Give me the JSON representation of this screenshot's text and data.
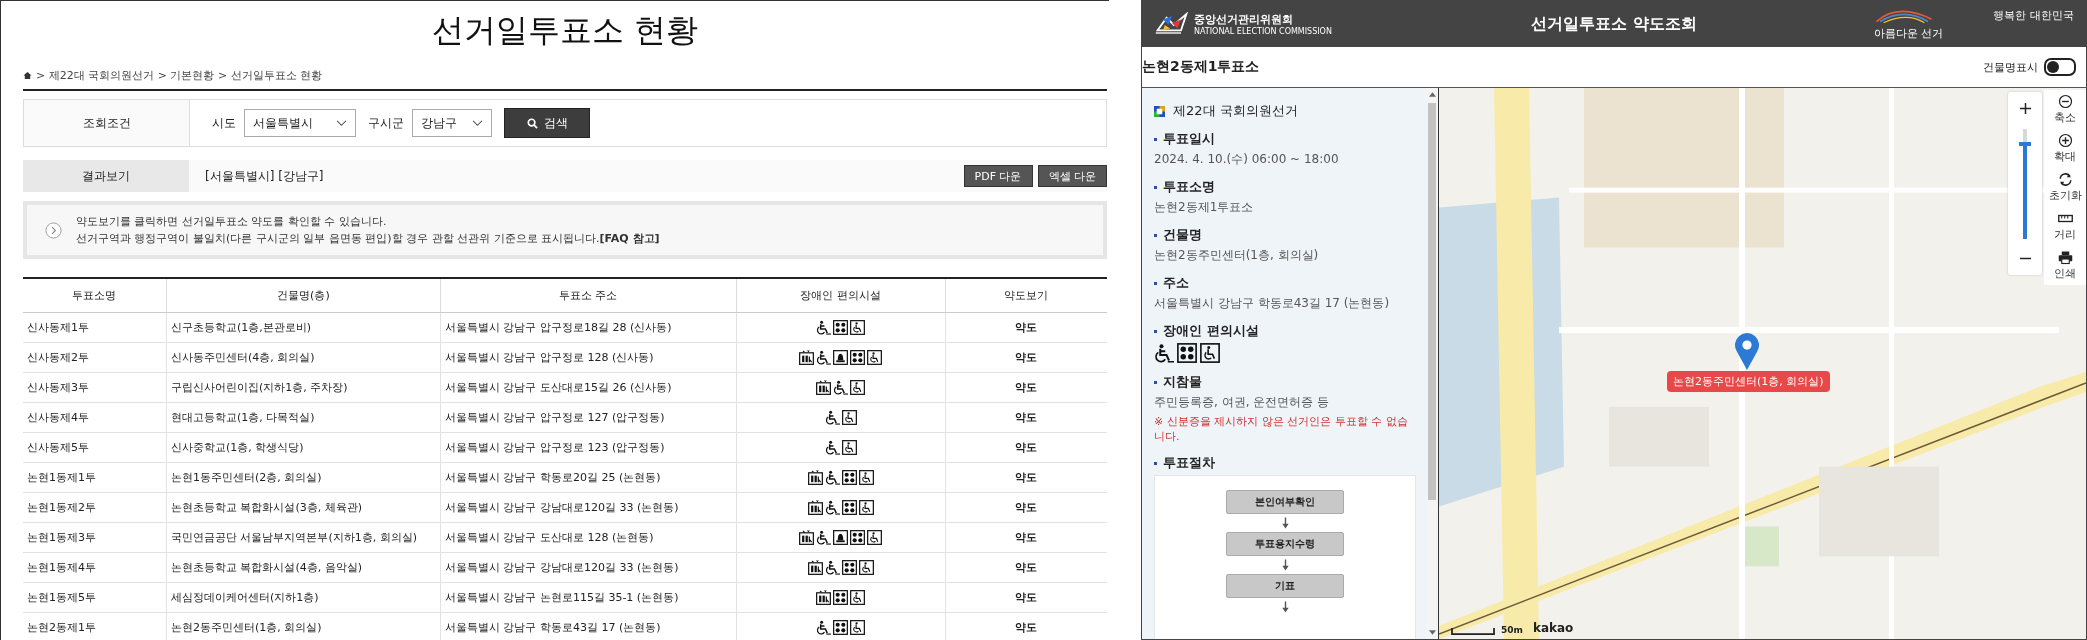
{
  "left": {
    "title": "선거일투표소 현황",
    "breadcrumb": "> 제22대 국회의원선거 > 기본현황 > 선거일투표소 현황",
    "filter": {
      "label": "조회조건",
      "fields": [
        {
          "label": "시도",
          "value": "서울특별시"
        },
        {
          "label": "구시군",
          "value": "강남구"
        }
      ],
      "search_button": "검색"
    },
    "results": {
      "label": "결과보기",
      "summary": "[서울특별시] [강남구]",
      "buttons": [
        "PDF 다운",
        "엑셀 다운"
      ]
    },
    "notice": [
      "약도보기를 클릭하면 선거일투표소 약도를 확인할 수 있습니다.",
      "선거구역과 행정구역이 불일치(다른 구시군의 일부 읍면동 편입)할 경우 관할 선관위 기준으로 표시됩니다.**[FAQ 참고]**"
    ],
    "table": {
      "columns": [
        "투표소명",
        "건물명(층)",
        "투표소 주소",
        "장애인 편의시설",
        "약도보기"
      ],
      "rows": [
        {
          "name": "신사동제1투",
          "building": "신구초등학교(1층,본관로비)",
          "address": "서울특별시 강남구 압구정로18길 28 (신사동)",
          "facilities": [
            {
              "kind": "ramp"
            },
            {
              "kind": "braille"
            },
            {
              "kind": "toilet"
            }
          ],
          "map_link": "약도"
        },
        {
          "name": "신사동제2투",
          "building": "신사동주민센터(4층, 회의실)",
          "address": "서울특별시 강남구 압구정로 128 (신사동)",
          "facilities": [
            {
              "kind": "lift"
            },
            {
              "kind": "ramp"
            },
            {
              "kind": "bell"
            },
            {
              "kind": "braille"
            },
            {
              "kind": "toilet"
            }
          ],
          "map_link": "약도"
        },
        {
          "name": "신사동제3투",
          "building": "구립신사어린이집(지하1층, 주차장)",
          "address": "서울특별시 강남구 도산대로15길 26 (신사동)",
          "facilities": [
            {
              "kind": "lift"
            },
            {
              "kind": "ramp"
            },
            {
              "kind": "toilet"
            }
          ],
          "map_link": "약도"
        },
        {
          "name": "신사동제4투",
          "building": "현대고등학교(1층, 다목적실)",
          "address": "서울특별시 강남구 압구정로 127 (압구정동)",
          "facilities": [
            {
              "kind": "ramp"
            },
            {
              "kind": "toilet"
            }
          ],
          "map_link": "약도"
        },
        {
          "name": "신사동제5투",
          "building": "신사중학교(1층, 학생식당)",
          "address": "서울특별시 강남구 압구정로 123 (압구정동)",
          "facilities": [
            {
              "kind": "ramp"
            },
            {
              "kind": "toilet"
            }
          ],
          "map_link": "약도"
        },
        {
          "name": "논현1동제1투",
          "building": "논현1동주민센터(2층, 회의실)",
          "address": "서울특별시 강남구 학동로20길 25 (논현동)",
          "facilities": [
            {
              "kind": "lift"
            },
            {
              "kind": "ramp"
            },
            {
              "kind": "braille"
            },
            {
              "kind": "toilet"
            }
          ],
          "map_link": "약도"
        },
        {
          "name": "논현1동제2투",
          "building": "논현초등학교 복합화시설(3층, 체육관)",
          "address": "서울특별시 강남구 강남대로120길 33 (논현동)",
          "facilities": [
            {
              "kind": "lift"
            },
            {
              "kind": "ramp"
            },
            {
              "kind": "braille"
            },
            {
              "kind": "toilet"
            }
          ],
          "map_link": "약도"
        },
        {
          "name": "논현1동제3투",
          "building": "국민연금공단 서울남부지역본부(지하1층, 회의실)",
          "address": "서울특별시 강남구 도산대로 128 (논현동)",
          "facilities": [
            {
              "kind": "lift"
            },
            {
              "kind": "ramp"
            },
            {
              "kind": "bell"
            },
            {
              "kind": "braille"
            },
            {
              "kind": "toilet"
            }
          ],
          "map_link": "약도"
        },
        {
          "name": "논현1동제4투",
          "building": "논현초등학교 복합화시설(4층, 음악실)",
          "address": "서울특별시 강남구 강남대로120길 33 (논현동)",
          "facilities": [
            {
              "kind": "lift"
            },
            {
              "kind": "ramp"
            },
            {
              "kind": "braille"
            },
            {
              "kind": "toilet"
            }
          ],
          "map_link": "약도"
        },
        {
          "name": "논현1동제5투",
          "building": "세심정데이케어센터(지하1층)",
          "address": "서울특별시 강남구 논현로115길 35-1 (논현동)",
          "facilities": [
            {
              "kind": "lift"
            },
            {
              "kind": "braille"
            },
            {
              "kind": "toilet"
            }
          ],
          "map_link": "약도"
        },
        {
          "name": "논현2동제1투",
          "building": "논현2동주민센터(1층, 회의실)",
          "address": "서울특별시 강남구 학동로43길 17 (논현동)",
          "facilities": [
            {
              "kind": "ramp"
            },
            {
              "kind": "braille"
            },
            {
              "kind": "toilet"
            }
          ],
          "map_link": "약도"
        }
      ]
    }
  },
  "viewer": {
    "logo_name": "중앙선거관리위원회",
    "logo_sub": "NATIONAL ELECTION COMMISSION",
    "title": "선거일투표소 약도조회",
    "slogan": [
      "아름다운 선거",
      "행복한 대한민국"
    ],
    "place": "논현2동제1투표소",
    "building_toggle": {
      "label": "건물명표시",
      "on": false
    },
    "election": "제22대 국회의원선거",
    "sections": [
      {
        "kind": "text",
        "heading": "투표일시",
        "value": "2024. 4. 10.(수) 06:00 ~ 18:00"
      },
      {
        "kind": "text",
        "heading": "투표소명",
        "value": "논현2동제1투표소"
      },
      {
        "kind": "text",
        "heading": "건물명",
        "value": "논현2동주민센터(1층, 회의실)"
      },
      {
        "kind": "text",
        "heading": "주소",
        "value": "서울특별시 강남구 학동로43길 17 (논현동)"
      },
      {
        "kind": "icons",
        "heading": "장애인 편의시설",
        "facilities": [
          {
            "kind": "ramp"
          },
          {
            "kind": "braille"
          },
          {
            "kind": "toilet"
          }
        ]
      },
      {
        "kind": "text",
        "heading": "지참물",
        "value": "주민등록증, 여권, 운전면허증 등",
        "warning": "※ 신분증을 제시하지 않은 선거인은 투표할 수 없습니다."
      },
      {
        "kind": "flow",
        "heading": "투표절차",
        "steps": [
          "본인여부확인",
          "투표용지수령",
          "기표"
        ]
      }
    ],
    "map": {
      "marker_label": "논현2동주민센터(1층, 회의실)",
      "zoom": {
        "level": 0.85
      },
      "tools": [
        {
          "kind": "zoom-out",
          "label": "축소"
        },
        {
          "kind": "zoom-in",
          "label": "확대"
        },
        {
          "kind": "reset",
          "label": "초기화"
        },
        {
          "kind": "ruler",
          "label": "거리"
        },
        {
          "kind": "print",
          "label": "인쇄"
        }
      ],
      "scale": "50m",
      "attribution": "kakao"
    }
  }
}
